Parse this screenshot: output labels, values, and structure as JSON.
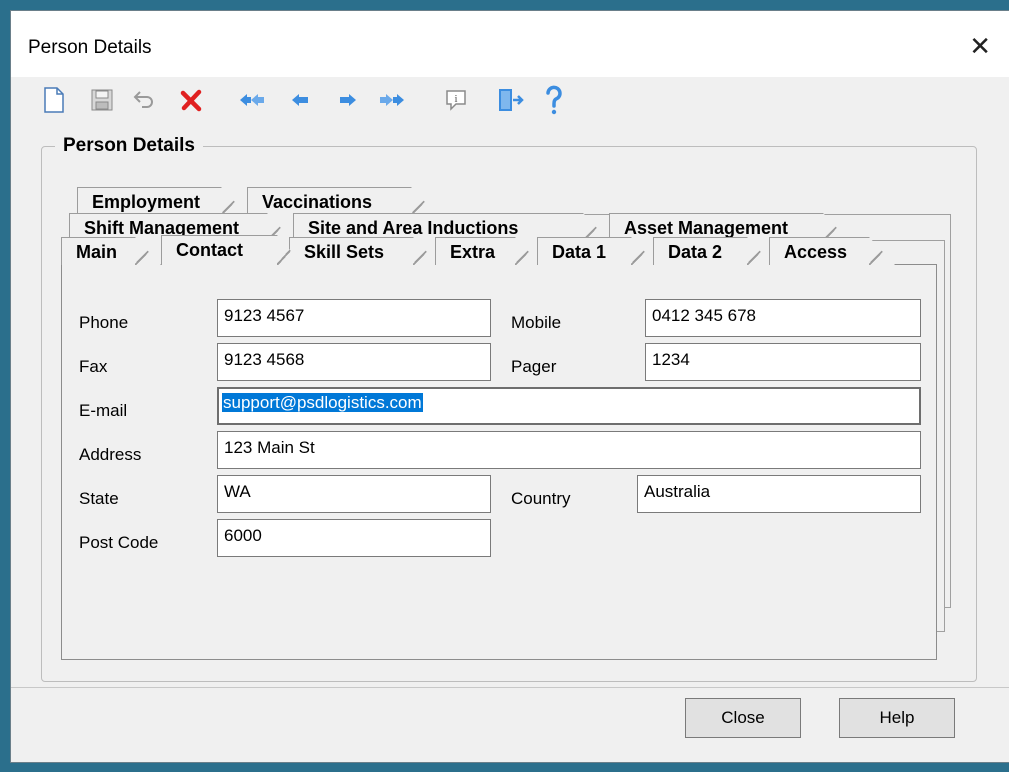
{
  "window": {
    "title": "Person Details",
    "close_glyph": "✕"
  },
  "toolbar": {
    "buttons": [
      {
        "name": "new-icon"
      },
      {
        "name": "save-icon"
      },
      {
        "name": "undo-icon"
      },
      {
        "name": "delete-icon"
      },
      {
        "name": "first-record-icon"
      },
      {
        "name": "previous-record-icon"
      },
      {
        "name": "next-record-icon"
      },
      {
        "name": "last-record-icon"
      },
      {
        "name": "info-icon"
      },
      {
        "name": "exit-icon"
      },
      {
        "name": "help-icon"
      }
    ]
  },
  "group": {
    "title": "Person Details"
  },
  "tabs": {
    "row3": [
      "Employment",
      "Vaccinations"
    ],
    "row2": [
      "Shift Management",
      "Site and Area Inductions",
      "Asset Management"
    ],
    "row1": [
      "Main",
      "Contact",
      "Skill Sets",
      "Extra",
      "Data 1",
      "Data 2",
      "Access"
    ],
    "active": "Contact"
  },
  "contact": {
    "phone": {
      "label": "Phone",
      "value": "9123 4567"
    },
    "mobile": {
      "label": "Mobile",
      "value": "0412 345 678"
    },
    "fax": {
      "label": "Fax",
      "value": "9123 4568"
    },
    "pager": {
      "label": "Pager",
      "value": "1234"
    },
    "email": {
      "label": "E-mail",
      "value": "support@psdlogistics.com"
    },
    "address": {
      "label": "Address",
      "value": "123 Main St"
    },
    "state": {
      "label": "State",
      "value": "WA"
    },
    "country": {
      "label": "Country",
      "value": "Australia"
    },
    "postcode": {
      "label": "Post Code",
      "value": "6000"
    }
  },
  "footer": {
    "close_label": "Close",
    "help_label": "Help"
  },
  "colors": {
    "background": "#2b6f8c",
    "selection": "#0078d7",
    "delete": "#e02020",
    "arrows": "#3c8de0"
  }
}
